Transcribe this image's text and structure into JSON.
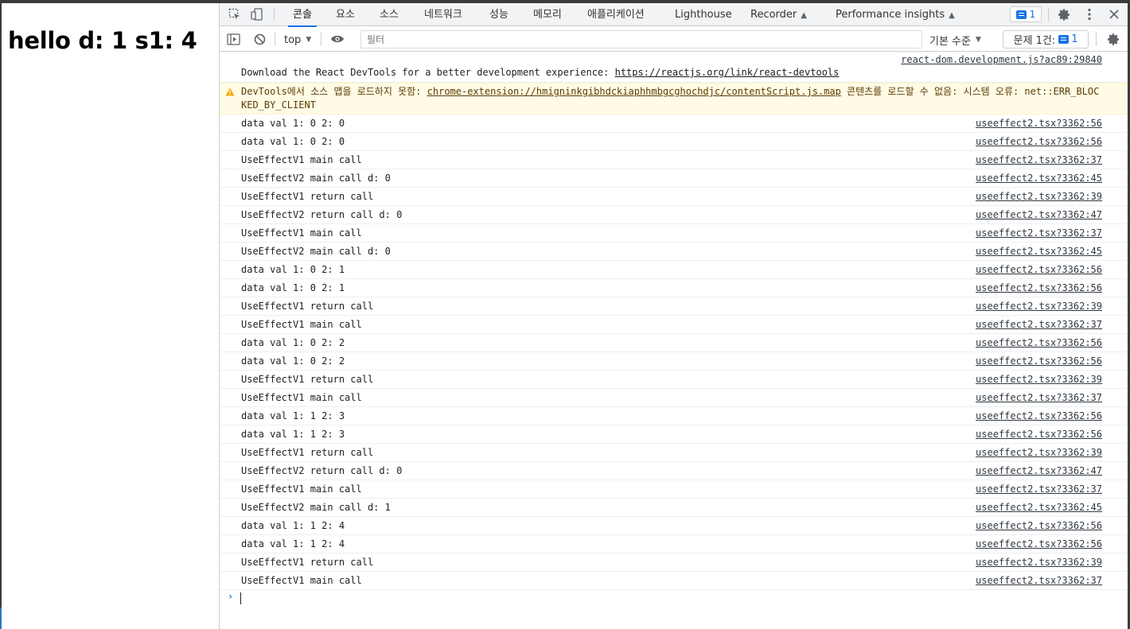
{
  "page": {
    "heading": "hello d: 1 s1: 4"
  },
  "devtools": {
    "tabs": [
      "콘솔",
      "요소",
      "소스",
      "네트워크",
      "성능",
      "메모리",
      "애플리케이션",
      "Lighthouse",
      "Recorder",
      "Performance insights"
    ],
    "active_tab": "콘솔",
    "issues_badge_count": "1",
    "icons": {
      "inspect": "inspect-element-icon",
      "device": "device-toolbar-icon",
      "settings": "gear-icon",
      "more": "more-vertical-icon",
      "close": "close-icon",
      "sidebar": "sidebar-toggle-icon",
      "clear": "clear-console-icon",
      "eye": "live-expression-icon",
      "flask": "experimental-flask-icon",
      "warning": "warning-icon",
      "message": "message-icon"
    }
  },
  "filterbar": {
    "context": "top",
    "filter_placeholder": "필터",
    "level": "기본 수준",
    "issues_label": "문제 1건:",
    "issues_count": "1"
  },
  "console": {
    "info": {
      "source": "react-dom.development.js?ac89:29840",
      "text": "Download the React DevTools for a better development experience: ",
      "link": "https://reactjs.org/link/react-devtools"
    },
    "warning": {
      "prefix": "DevTools에서 소스 맵을 로드하지 못함: ",
      "link": "chrome-extension://hmigninkgibhdckiaphhmbgcghochdjc/contentScript.js.map",
      "suffix": " 콘텐츠를 로드할 수 없음: 시스템 오류: net::ERR_BLOCKED_BY_CLIENT"
    },
    "rows": [
      {
        "text": "data val 1: 0 2: 0",
        "src": "useeffect2.tsx?3362:56"
      },
      {
        "text": "data val 1: 0 2: 0",
        "src": "useeffect2.tsx?3362:56"
      },
      {
        "text": "UseEffectV1 main call",
        "src": "useeffect2.tsx?3362:37"
      },
      {
        "text": "UseEffectV2 main call d: 0",
        "src": "useeffect2.tsx?3362:45"
      },
      {
        "text": "UseEffectV1 return call",
        "src": "useeffect2.tsx?3362:39"
      },
      {
        "text": "UseEffectV2 return call d: 0",
        "src": "useeffect2.tsx?3362:47"
      },
      {
        "text": "UseEffectV1 main call",
        "src": "useeffect2.tsx?3362:37"
      },
      {
        "text": "UseEffectV2 main call d: 0",
        "src": "useeffect2.tsx?3362:45"
      },
      {
        "text": "data val 1: 0 2: 1",
        "src": "useeffect2.tsx?3362:56"
      },
      {
        "text": "data val 1: 0 2: 1",
        "src": "useeffect2.tsx?3362:56"
      },
      {
        "text": "UseEffectV1 return call",
        "src": "useeffect2.tsx?3362:39"
      },
      {
        "text": "UseEffectV1 main call",
        "src": "useeffect2.tsx?3362:37"
      },
      {
        "text": "data val 1: 0 2: 2",
        "src": "useeffect2.tsx?3362:56"
      },
      {
        "text": "data val 1: 0 2: 2",
        "src": "useeffect2.tsx?3362:56"
      },
      {
        "text": "UseEffectV1 return call",
        "src": "useeffect2.tsx?3362:39"
      },
      {
        "text": "UseEffectV1 main call",
        "src": "useeffect2.tsx?3362:37"
      },
      {
        "text": "data val 1: 1 2: 3",
        "src": "useeffect2.tsx?3362:56"
      },
      {
        "text": "data val 1: 1 2: 3",
        "src": "useeffect2.tsx?3362:56"
      },
      {
        "text": "UseEffectV1 return call",
        "src": "useeffect2.tsx?3362:39"
      },
      {
        "text": "UseEffectV2 return call d: 0",
        "src": "useeffect2.tsx?3362:47"
      },
      {
        "text": "UseEffectV1 main call",
        "src": "useeffect2.tsx?3362:37"
      },
      {
        "text": "UseEffectV2 main call d: 1",
        "src": "useeffect2.tsx?3362:45"
      },
      {
        "text": "data val 1: 1 2: 4",
        "src": "useeffect2.tsx?3362:56"
      },
      {
        "text": "data val 1: 1 2: 4",
        "src": "useeffect2.tsx?3362:56"
      },
      {
        "text": "UseEffectV1 return call",
        "src": "useeffect2.tsx?3362:39"
      },
      {
        "text": "UseEffectV1 main call",
        "src": "useeffect2.tsx?3362:37"
      }
    ],
    "prompt_symbol": "›"
  },
  "colors": {
    "accent": "#1a73e8",
    "warning_bg": "#fffbe5",
    "warning_text": "#5c3c00",
    "toolbar_bg": "#f1f3f4"
  }
}
